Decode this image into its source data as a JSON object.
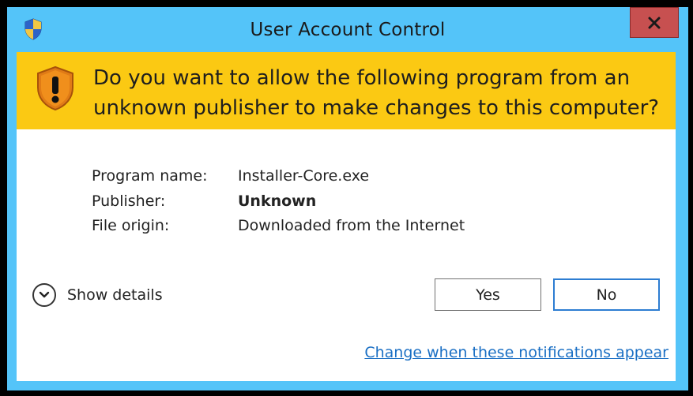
{
  "window": {
    "title": "User Account Control",
    "close_glyph": "✕"
  },
  "banner": {
    "question": "Do you want to allow the following program from an unknown publisher to make changes to this computer?"
  },
  "info": {
    "program_name_label": "Program name:",
    "program_name_value": "Installer-Core.exe",
    "publisher_label": "Publisher:",
    "publisher_value": "Unknown",
    "file_origin_label": "File origin:",
    "file_origin_value": "Downloaded from the Internet"
  },
  "details": {
    "label": "Show details"
  },
  "buttons": {
    "yes": "Yes",
    "no": "No"
  },
  "link": {
    "text": "Change when these notifications appear"
  },
  "icons": {
    "title": "uac-shield-icon",
    "banner": "warning-shield-icon",
    "details": "chevron-down-icon",
    "close": "close-icon"
  },
  "colors": {
    "frame": "#54c4f9",
    "banner": "#fbc913",
    "close_button": "#c75050",
    "link": "#1a6fc4",
    "default_button_border": "#2d7dd2"
  }
}
